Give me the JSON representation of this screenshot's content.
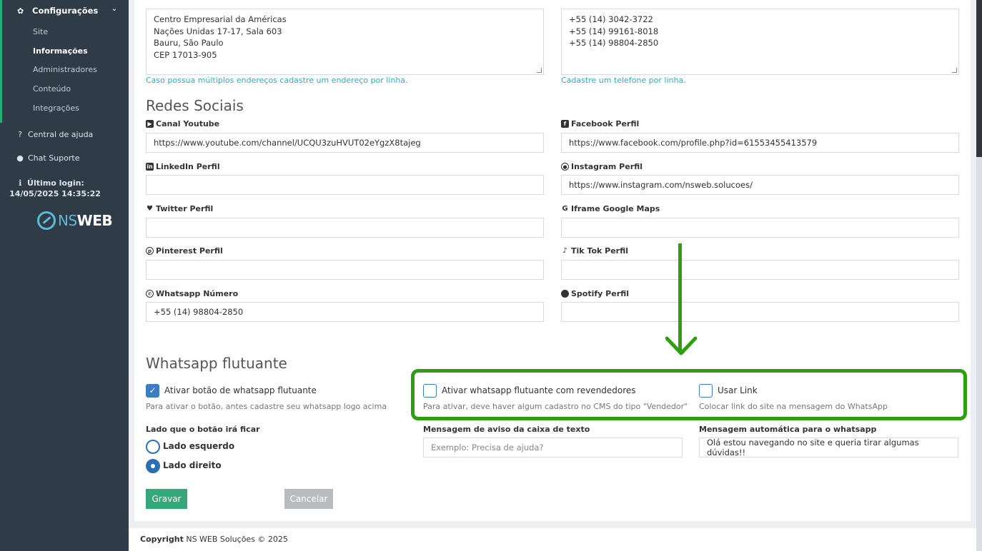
{
  "sidebar": {
    "section": "Configurações",
    "sub_items": [
      {
        "label": "Site",
        "active": false
      },
      {
        "label": "Informações",
        "active": true
      },
      {
        "label": "Administradores",
        "active": false
      },
      {
        "label": "Conteúdo",
        "active": false
      },
      {
        "label": "Integrações",
        "active": false
      }
    ],
    "help": "Central de ajuda",
    "chat": "Chat Suporte",
    "last_login_label": "Último login:",
    "last_login_value": "14/05/2025 14:35:22",
    "logo_ns": "NS",
    "logo_web": "WEB"
  },
  "contact": {
    "address_lines": [
      "Centro Empresarial da Américas",
      "Nações Unidas 17-17, Sala 603",
      "Bauru, São Paulo",
      "CEP 17013-905"
    ],
    "address_help": "Caso possua múltiplos endereços cadastre um endereço por linha.",
    "phone_lines": [
      "+55 (14) 3042-3722",
      "+55 (14) 99161-8018",
      "+55 (14) 98804-2850"
    ],
    "phone_help": "Cadastre um telefone por linha."
  },
  "social": {
    "title": "Redes Sociais",
    "youtube_label": "Canal Youtube",
    "youtube_value": "https://www.youtube.com/channel/UCQU3zuHVUT02eYgzX8tajeg",
    "facebook_label": "Facebook Perfil",
    "facebook_value": "https://www.facebook.com/profile.php?id=61553455413579",
    "linkedin_label": "LinkedIn Perfil",
    "linkedin_value": "",
    "instagram_label": "Instagram Perfil",
    "instagram_value": "https://www.instagram.com/nsweb.solucoes/",
    "twitter_label": "Twitter Perfil",
    "twitter_value": "",
    "gmaps_label": "Iframe Google Maps",
    "gmaps_value": "",
    "pinterest_label": "Pinterest Perfil",
    "pinterest_value": "",
    "tiktok_label": "Tik Tok Perfil",
    "tiktok_value": "",
    "whatsapp_label": "Whatsapp Número",
    "whatsapp_value": "+55 (14) 98804-2850",
    "spotify_label": "Spotify Perfil",
    "spotify_value": ""
  },
  "whatsapp": {
    "title": "Whatsapp flutuante",
    "enable_label": "Ativar botão de whatsapp flutuante",
    "enable_checked": true,
    "enable_help": "Para ativar o botão, antes cadastre seu whatsapp logo acima",
    "resellers_label": "Ativar whatsapp flutuante com revendedores",
    "resellers_checked": false,
    "resellers_help": "Para ativar, deve haver algum cadastro no CMS do tipo \"Vendedor\"",
    "use_link_label": "Usar Link",
    "use_link_checked": false,
    "use_link_help": "Colocar link do site na mensagem do WhatsApp",
    "side_label": "Lado que o botão irá ficar",
    "side_left": "Lado esquerdo",
    "side_right": "Lado direito",
    "side_selected": "right",
    "msg_label": "Mensagem de aviso da caixa de texto",
    "msg_placeholder": "Exemplo: Precisa de ajuda?",
    "auto_label": "Mensagem automática para o whatsapp",
    "auto_value": "Olá estou navegando no site e queria tirar algumas dúvidas!!"
  },
  "actions": {
    "save": "Gravar",
    "cancel": "Cancelar"
  },
  "footer": {
    "copyright_bold": "Copyright",
    "copyright_rest": " NS WEB Soluções © 2025"
  },
  "colors": {
    "sidebar_bg": "#2f3b47",
    "accent_green": "#27ae73",
    "annotation_green": "#2e9f11",
    "checkbox_blue": "#3b7dc4",
    "help_text": "#3aa7c3"
  }
}
